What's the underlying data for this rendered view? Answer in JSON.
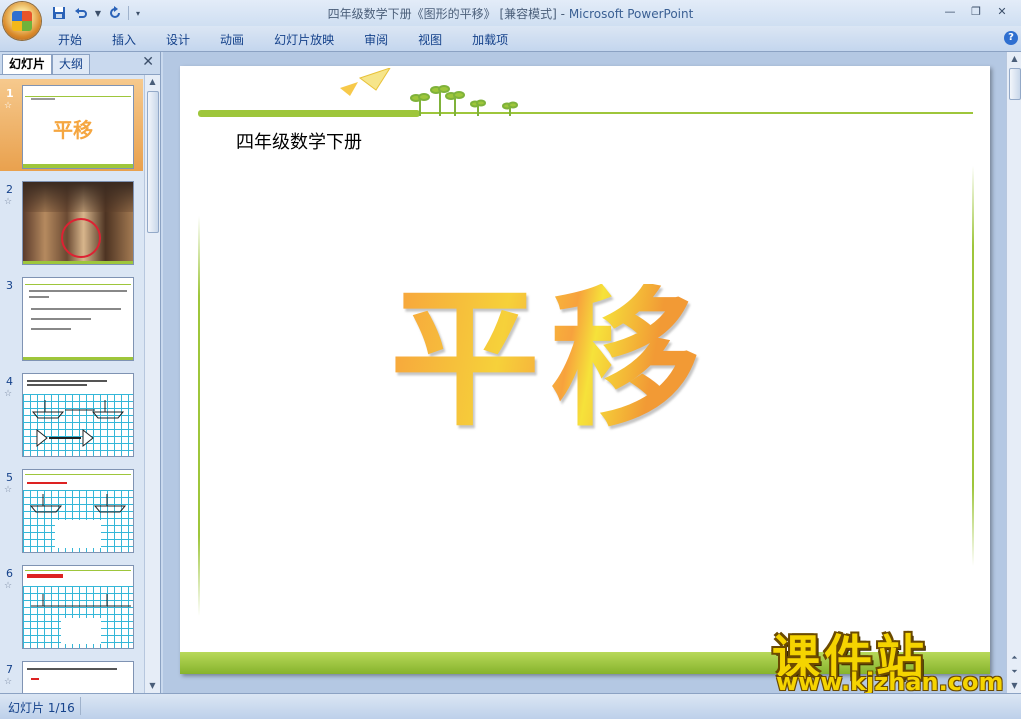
{
  "window": {
    "title": "四年级数学下册《图形的平移》 [兼容模式] - ",
    "app_name": "Microsoft PowerPoint"
  },
  "ribbon": {
    "tabs": [
      "开始",
      "插入",
      "设计",
      "动画",
      "幻灯片放映",
      "审阅",
      "视图",
      "加载项"
    ]
  },
  "left_pane": {
    "tab_slides": "幻灯片",
    "tab_outline": "大纲",
    "slides": [
      {
        "num": "1",
        "title": "平移",
        "selected": true
      },
      {
        "num": "2"
      },
      {
        "num": "3"
      },
      {
        "num": "4"
      },
      {
        "num": "5"
      },
      {
        "num": "6"
      },
      {
        "num": "7"
      }
    ]
  },
  "slide": {
    "header": "四年级数学下册",
    "title": "平移"
  },
  "watermark": {
    "text_cn": "课件站",
    "url": "www.kjzhan.com"
  },
  "status": {
    "slide_position": "幻灯片 1/16"
  },
  "colors": {
    "accent_green": "#9ec63b",
    "title_orange": "#f7a23d",
    "title_yellow": "#f6d13a",
    "selection": "#e9a14e"
  }
}
